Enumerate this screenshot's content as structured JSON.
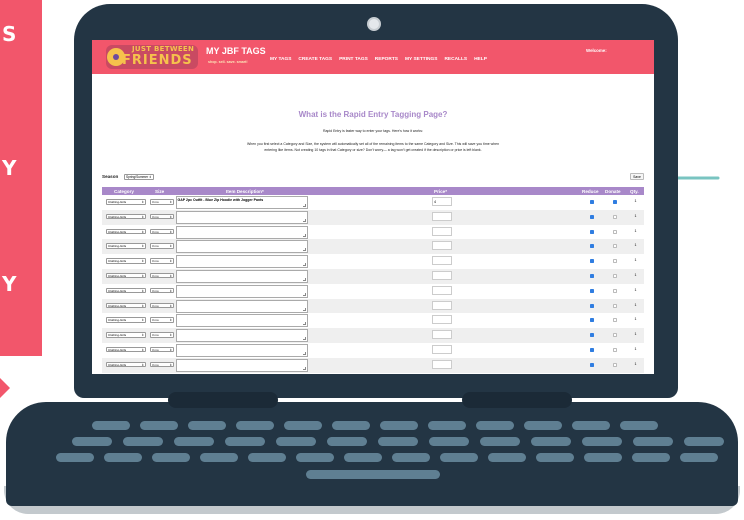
{
  "side_letters": [
    "S",
    "Y",
    "Y"
  ],
  "app": {
    "logo_top": "JUST BETWEEN",
    "logo_main": "FRIENDS",
    "title": "MY JBF TAGS",
    "tagline": "shop. sell. save. smart!",
    "welcome": "Welcome:",
    "nav": [
      "MY TAGS",
      "CREATE TAGS",
      "PRINT TAGS",
      "REPORTS",
      "MY SETTINGS",
      "RECALLS",
      "HELP"
    ]
  },
  "page": {
    "title": "What is the Rapid Entry Tagging Page?",
    "intro": "Rapid Entry is faster way to enter your tags.   Here's how it works:",
    "description": "When you first select a Category and Size, the system will automatically set all of the remaining items to the same Category and Size. This will save you time when entering like items. Not creating 10 tags in that Category or size? Don't worry— a tag won't get created if the description or price is left blank.",
    "season_label": "Season",
    "season_value": "Spring/Summer",
    "save_label": "Save"
  },
  "table": {
    "headers": {
      "category": "Category",
      "size": "Size",
      "description": "Item Description*",
      "price": "Price*",
      "reduce": "Reduce",
      "donate": "Donate",
      "qty": "Qty."
    },
    "rows": [
      {
        "category": "Clothing-Girls",
        "size": "3 mo",
        "description": "GAP 2pc Outfit - Blue Zip Hoodie with Jogger Pants",
        "price": "4",
        "reduce": true,
        "donate": true,
        "qty": "1"
      },
      {
        "category": "Clothing-Girls",
        "size": "3 mo",
        "description": "",
        "price": "",
        "reduce": true,
        "donate": false,
        "qty": "1"
      },
      {
        "category": "Clothing-Girls",
        "size": "3 mo",
        "description": "",
        "price": "",
        "reduce": true,
        "donate": false,
        "qty": "1"
      },
      {
        "category": "Clothing-Girls",
        "size": "3 mo",
        "description": "",
        "price": "",
        "reduce": true,
        "donate": false,
        "qty": "1"
      },
      {
        "category": "Clothing-Girls",
        "size": "3 mo",
        "description": "",
        "price": "",
        "reduce": true,
        "donate": false,
        "qty": "1"
      },
      {
        "category": "Clothing-Girls",
        "size": "3 mo",
        "description": "",
        "price": "",
        "reduce": true,
        "donate": false,
        "qty": "1"
      },
      {
        "category": "Clothing-Girls",
        "size": "3 mo",
        "description": "",
        "price": "",
        "reduce": true,
        "donate": false,
        "qty": "1"
      },
      {
        "category": "Clothing-Girls",
        "size": "3 mo",
        "description": "",
        "price": "",
        "reduce": true,
        "donate": false,
        "qty": "1"
      },
      {
        "category": "Clothing-Girls",
        "size": "3 mo",
        "description": "",
        "price": "",
        "reduce": true,
        "donate": false,
        "qty": "1"
      },
      {
        "category": "Clothing-Girls",
        "size": "3 mo",
        "description": "",
        "price": "",
        "reduce": true,
        "donate": false,
        "qty": "1"
      },
      {
        "category": "Clothing-Girls",
        "size": "3 mo",
        "description": "",
        "price": "",
        "reduce": true,
        "donate": false,
        "qty": "1"
      },
      {
        "category": "Clothing-Girls",
        "size": "3 mo",
        "description": "",
        "price": "",
        "reduce": true,
        "donate": false,
        "qty": "1"
      }
    ]
  },
  "colors": {
    "brand_pink": "#f2566b",
    "header_purple": "#a888c9",
    "laptop_navy": "#233544",
    "checkbox_blue": "#2f7de1",
    "arrow_teal": "#79c4c1"
  }
}
